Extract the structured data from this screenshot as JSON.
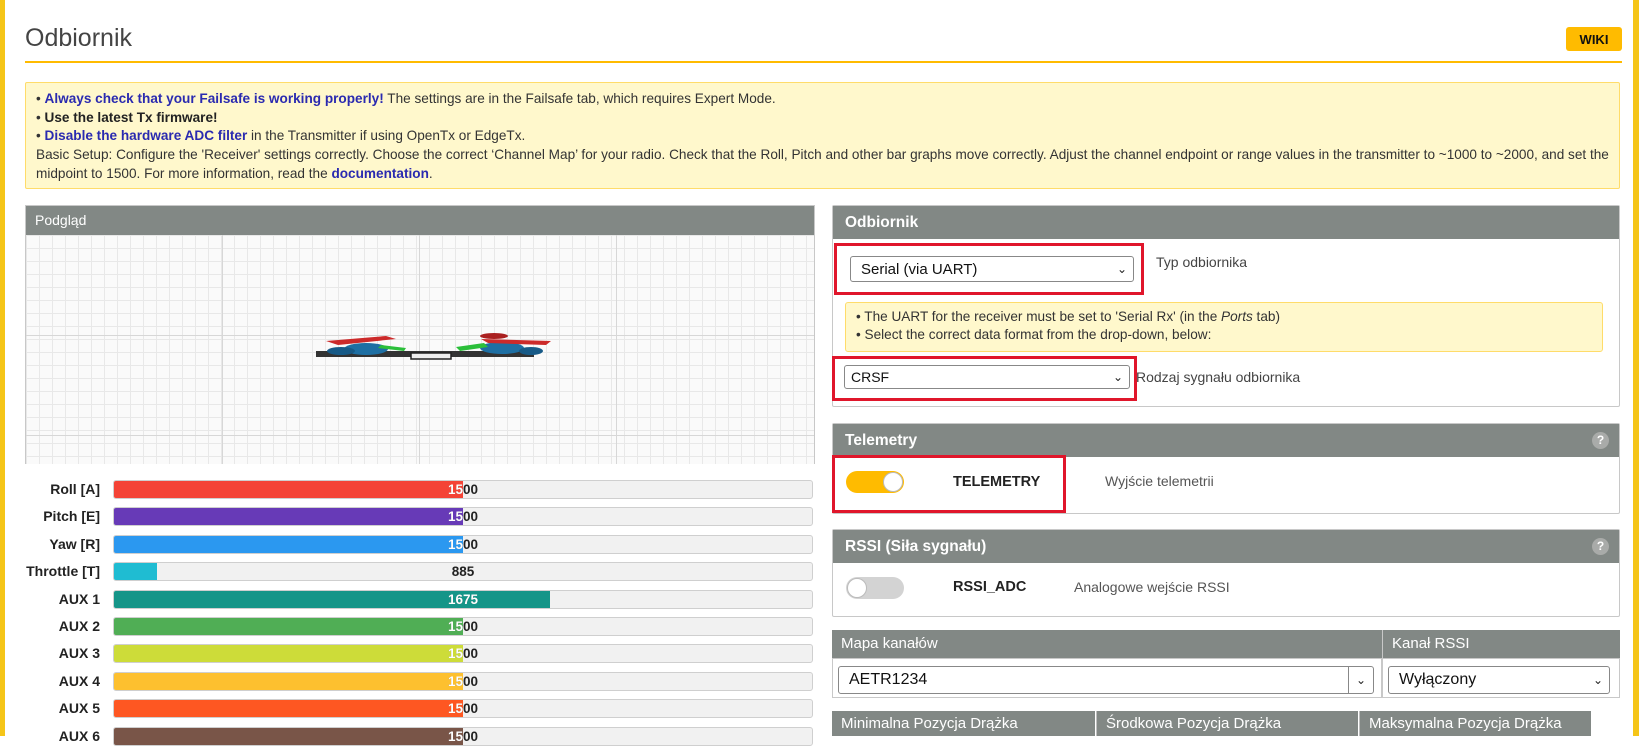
{
  "page": {
    "title": "Odbiornik",
    "wiki_label": "WIKI"
  },
  "note": {
    "line1_strong": "Always check that your Failsafe is working properly!",
    "line1_rest": " The settings are in the Failsafe tab, which requires Expert Mode.",
    "line2_strong": "Use the latest Tx firmware!",
    "line3_strong": "Disable the hardware ADC filter",
    "line3_rest": " in the Transmitter if using OpenTx or EdgeTx.",
    "line4": "Basic Setup: Configure the 'Receiver' settings correctly. Choose the correct ‘Channel Map’ for your radio. Check that the Roll, Pitch and other bar graphs move correctly. Adjust the channel endpoint or range values in the transmitter to ~1000 to ~2000, and set the midpoint to 1500. For more information, read the ",
    "line4_link": "documentation",
    "line4_end": ".",
    "bullet": "•"
  },
  "preview": {
    "title": "Podgląd"
  },
  "channels": [
    {
      "label": "Roll [A]",
      "value": "1500",
      "fraction": 0.5,
      "color": "#f44336"
    },
    {
      "label": "Pitch [E]",
      "value": "1500",
      "fraction": 0.5,
      "color": "#673ab7"
    },
    {
      "label": "Yaw [R]",
      "value": "1500",
      "fraction": 0.5,
      "color": "#2b98f0"
    },
    {
      "label": "Throttle [T]",
      "value": "885",
      "fraction": 0.062,
      "color": "#1fbcd2"
    },
    {
      "label": "AUX 1",
      "value": "1675",
      "fraction": 0.625,
      "color": "#159588"
    },
    {
      "label": "AUX 2",
      "value": "1500",
      "fraction": 0.5,
      "color": "#50ae55"
    },
    {
      "label": "AUX 3",
      "value": "1500",
      "fraction": 0.5,
      "color": "#cddc39"
    },
    {
      "label": "AUX 4",
      "value": "1500",
      "fraction": 0.5,
      "color": "#fdc02f"
    },
    {
      "label": "AUX 5",
      "value": "1500",
      "fraction": 0.5,
      "color": "#fe5722"
    },
    {
      "label": "AUX 6",
      "value": "1500",
      "fraction": 0.5,
      "color": "#795548"
    }
  ],
  "receiver": {
    "title": "Odbiornik",
    "type_value": "Serial (via UART)",
    "type_label": "Typ odbiornika",
    "note_line1_a": "• The UART for the receiver must be set to 'Serial Rx' (in the ",
    "note_line1_em": "Ports",
    "note_line1_b": " tab)",
    "note_line2": "• Select the correct data format from the drop-down, below:",
    "provider_value": "CRSF",
    "provider_label": "Rodzaj sygnału odbiornika"
  },
  "telemetry": {
    "title": "Telemetry",
    "help": "?",
    "toggle_name": "TELEMETRY",
    "toggle_desc": "Wyjście telemetrii",
    "enabled": true
  },
  "rssi": {
    "title": "RSSI (Siła sygnału)",
    "help": "?",
    "toggle_name": "RSSI_ADC",
    "toggle_desc": "Analogowe wejście RSSI",
    "enabled": false
  },
  "channel_map": {
    "title": "Mapa kanałów",
    "value": "AETR1234"
  },
  "rssi_channel": {
    "title": "Kanał RSSI",
    "value": "Wyłączony"
  },
  "stick_headers": [
    "Minimalna Pozycja Drążka",
    "Środkowa Pozycja Drążka",
    "Maksymalna Pozycja Drążka"
  ],
  "colors": {
    "accent": "#ffbb00",
    "panel_header": "#828885",
    "highlight_red": "#e0162b",
    "note_bg": "#fff8cc"
  }
}
